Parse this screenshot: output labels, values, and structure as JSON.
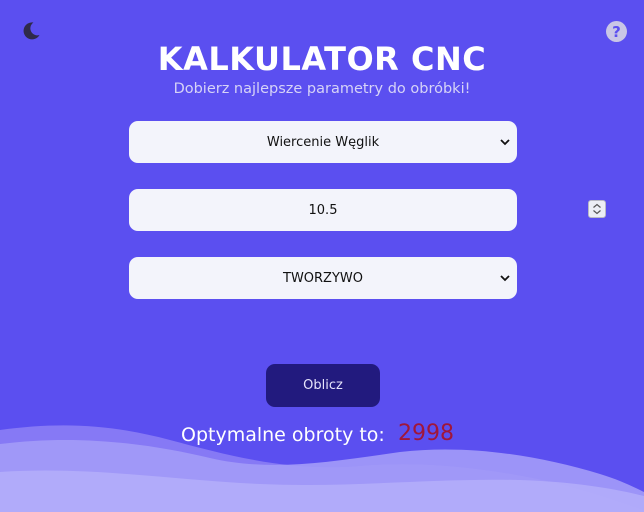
{
  "theme": {
    "accent": "#5b4ff0",
    "button": "#221a7e",
    "result_color": "#a0163a"
  },
  "header": {
    "title": "KALKULATOR CNC",
    "subtitle": "Dobierz najlepsze parametry do obróbki!",
    "theme_toggle_icon": "moon-icon",
    "help_icon": "question-mark-icon",
    "help_symbol": "?"
  },
  "form": {
    "operation": {
      "value": "Wiercenie Węglik"
    },
    "diameter": {
      "value": "10.5"
    },
    "material": {
      "value": "TWORZYWO"
    },
    "submit_label": "Oblicz"
  },
  "result": {
    "label": "Optymalne obroty to:",
    "value": "2998"
  }
}
